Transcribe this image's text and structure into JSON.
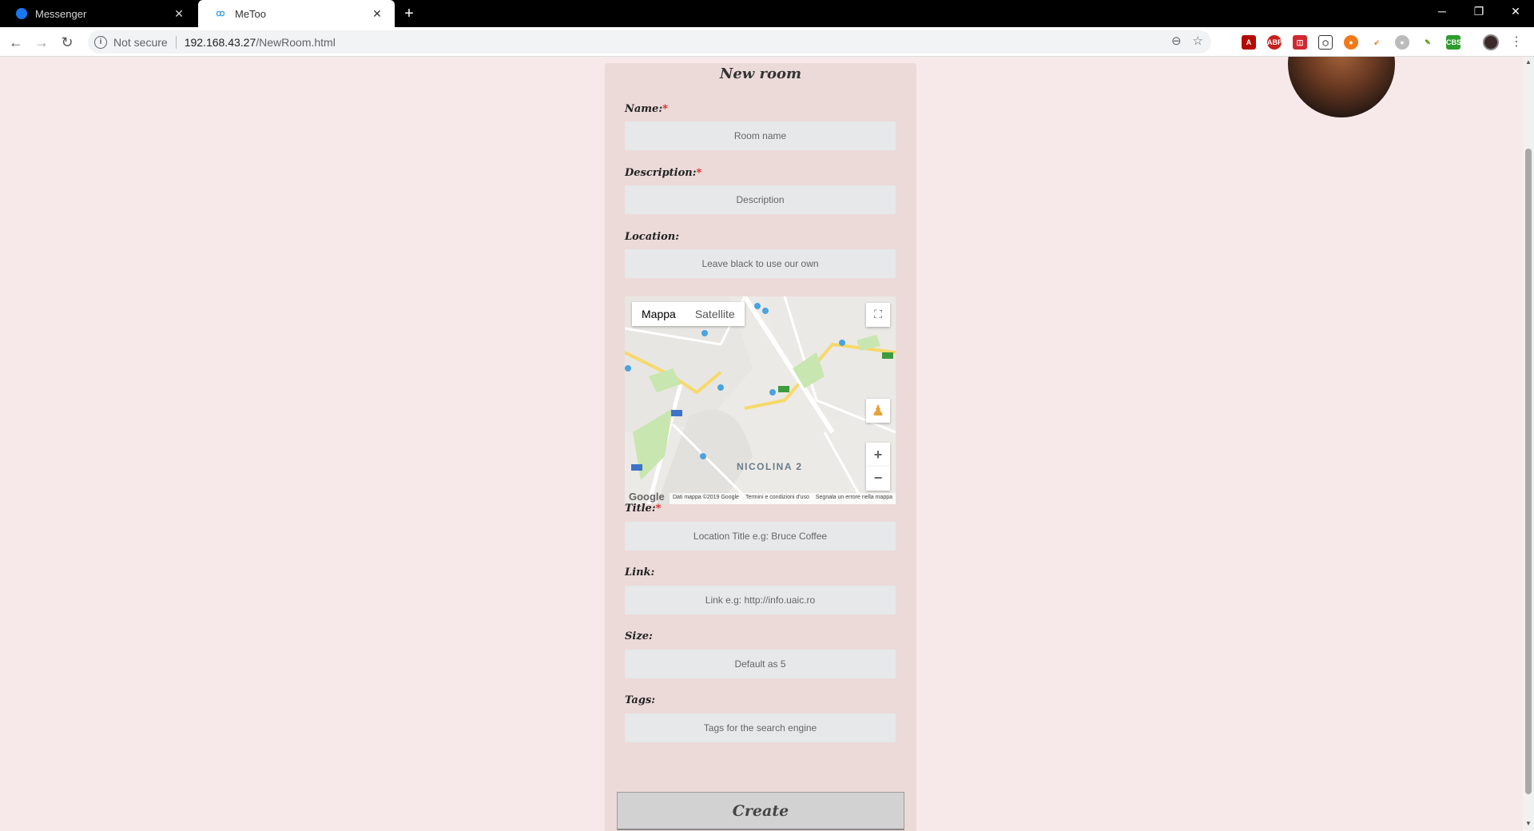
{
  "browser": {
    "tabs": [
      {
        "title": "Messenger",
        "active": false
      },
      {
        "title": "MeToo",
        "active": true
      }
    ],
    "security_label": "Not secure",
    "url_host": "192.168.43.27",
    "url_path": "/NewRoom.html",
    "extensions": [
      "acrobat-icon",
      "adblock-plus-icon",
      "red-extension-icon",
      "cube-extension-icon",
      "orange-extension-icon",
      "fox-extension-icon",
      "grey-extension-icon",
      "green-extension-icon",
      "cbs-extension-icon"
    ]
  },
  "form": {
    "heading": "New room",
    "name_label": "Name:",
    "name_placeholder": "Room name",
    "description_label": "Description:",
    "description_placeholder": "Description",
    "location_label": "Location:",
    "location_placeholder": "Leave black to use our own",
    "title_label": "Title:",
    "title_placeholder": "Location Title e.g: Bruce Coffee",
    "link_label": "Link:",
    "link_placeholder": "Link e.g: http://info.uaic.ro",
    "size_label": "Size:",
    "size_placeholder": "Default as 5",
    "tags_label": "Tags:",
    "tags_placeholder": "Tags for the search engine",
    "required_mark": "*",
    "create_label": "Create"
  },
  "map": {
    "type_map": "Mappa",
    "type_satellite": "Satellite",
    "place_label": "NICOLINA 2",
    "google": "Google",
    "footer_data": "Dati mappa ©2019 Google",
    "footer_terms": "Termini e condizioni d'uso",
    "footer_report": "Segnala un errore nella mappa"
  },
  "colors": {
    "page_bg": "#f7e9e9",
    "panel_bg": "#ebdad8",
    "field_bg": "#e6e8ea",
    "required": "#e02020"
  }
}
